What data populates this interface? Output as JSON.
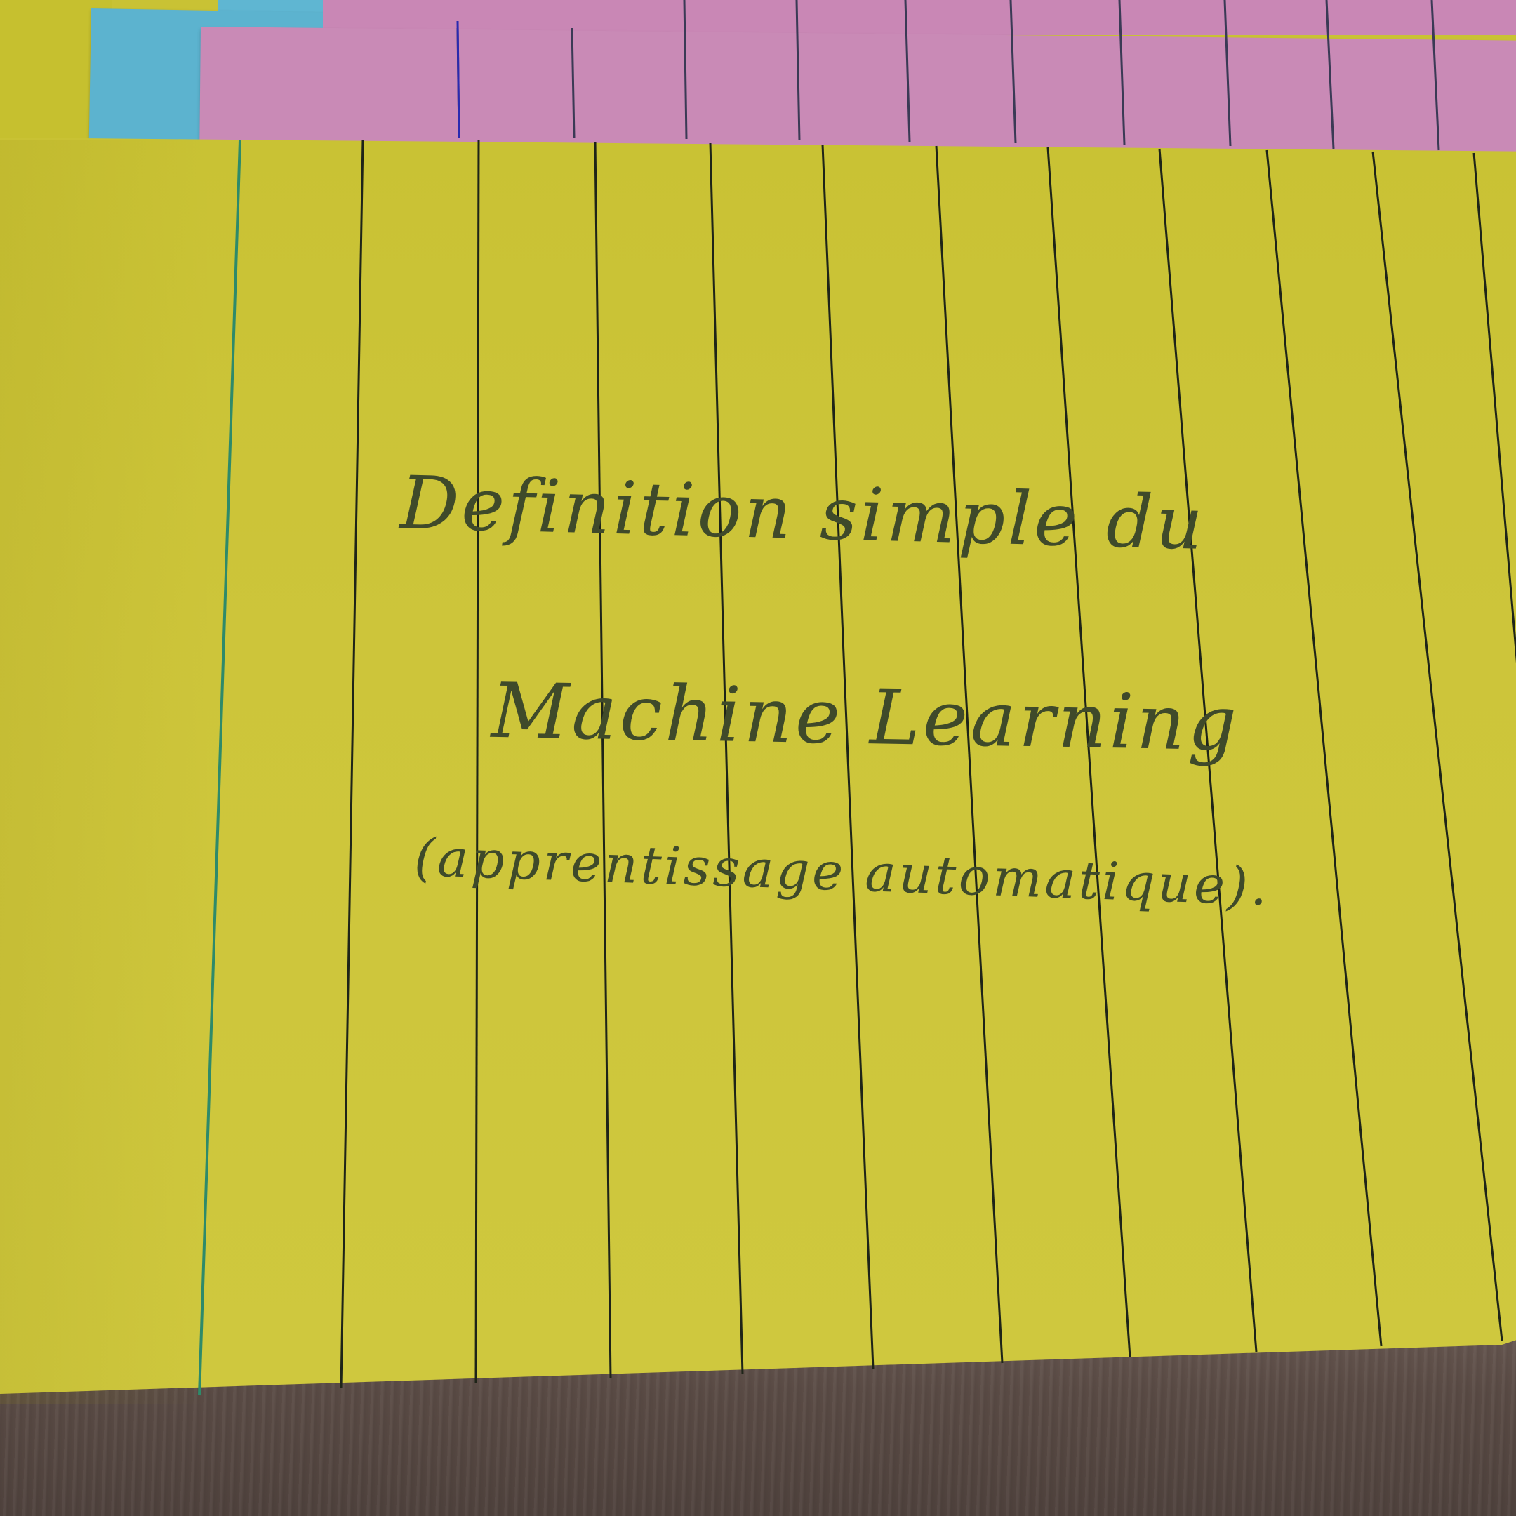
{
  "scene": {
    "title": "Photo of handwritten index cards",
    "card_colors": {
      "front_card": "#cdc53a",
      "pink_card": "#c98ab6",
      "blue_card": "#5cb3cf",
      "table": "#5a4b45",
      "ink": "#3f4a2a",
      "margin_line": "#2e8a6a"
    }
  },
  "note": {
    "line1": "Definition simple du",
    "line2": "Machine Learning",
    "line3": "(apprentissage automatique)."
  }
}
